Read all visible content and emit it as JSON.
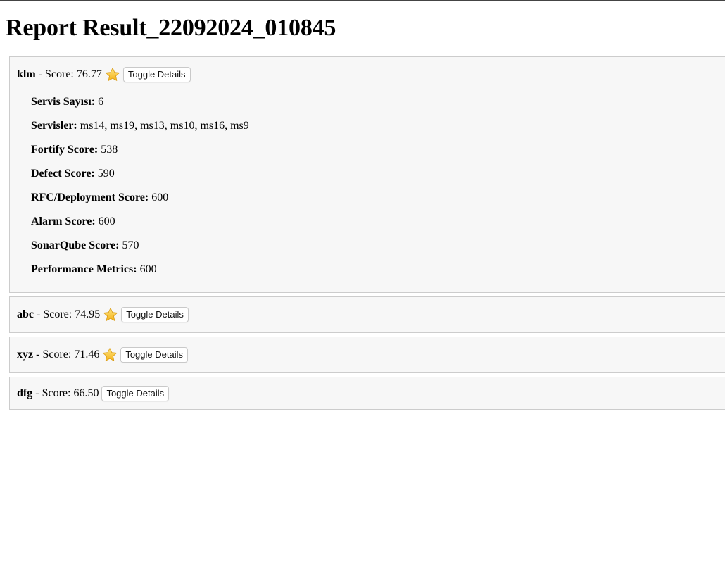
{
  "page": {
    "title": "Report Result_22092024_010845"
  },
  "projects": [
    {
      "name": "klm",
      "score_text": "- Score: 76.77",
      "has_star": true,
      "toggle_label": "Toggle Details",
      "expanded": true,
      "details": [
        {
          "label": "Servis Sayısı:",
          "value": "6"
        },
        {
          "label": "Servisler:",
          "value": "ms14, ms19, ms13, ms10, ms16, ms9"
        },
        {
          "label": "Fortify Score:",
          "value": "538"
        },
        {
          "label": "Defect Score:",
          "value": "590"
        },
        {
          "label": "RFC/Deployment Score:",
          "value": "600"
        },
        {
          "label": "Alarm Score:",
          "value": "600"
        },
        {
          "label": "SonarQube Score:",
          "value": "570"
        },
        {
          "label": "Performance Metrics:",
          "value": "600"
        }
      ]
    },
    {
      "name": "abc",
      "score_text": "- Score: 74.95",
      "has_star": true,
      "toggle_label": "Toggle Details",
      "expanded": false
    },
    {
      "name": "xyz",
      "score_text": "- Score: 71.46",
      "has_star": true,
      "toggle_label": "Toggle Details",
      "expanded": false
    },
    {
      "name": "dfg",
      "score_text": "- Score: 66.50",
      "has_star": false,
      "toggle_label": "Toggle Details",
      "expanded": false
    }
  ],
  "icons": {
    "star": "star-icon"
  },
  "colors": {
    "panel_background": "#f7f7f7",
    "panel_border": "#cccccc",
    "star_fill": "#f8c630"
  }
}
